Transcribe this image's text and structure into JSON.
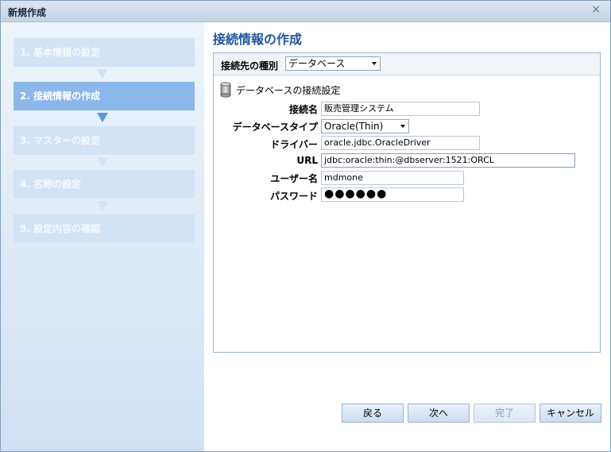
{
  "window": {
    "title": "新規作成",
    "close_glyph": "×"
  },
  "steps": [
    {
      "label": "1. 基本情報の設定",
      "active": false
    },
    {
      "label": "2. 接続情報の作成",
      "active": true
    },
    {
      "label": "3. マスターの設定",
      "active": false
    },
    {
      "label": "4. 名称の設定",
      "active": false
    },
    {
      "label": "5. 設定内容の確認",
      "active": false
    }
  ],
  "main": {
    "title": "接続情報の作成",
    "connection_type": {
      "label": "接続先の種別",
      "value": "データベース"
    },
    "section_title": "データベースの接続設定",
    "fields": {
      "name": {
        "label": "接続名",
        "value": "販売管理システム"
      },
      "db_type": {
        "label": "データベースタイプ",
        "value": "Oracle(Thin)"
      },
      "driver": {
        "label": "ドライバー",
        "value": "oracle.jdbc.OracleDriver"
      },
      "url": {
        "label": "URL",
        "value": "jdbc:oracle:thin:@dbserver:1521:ORCL"
      },
      "user": {
        "label": "ユーザー名",
        "value": "mdmone"
      },
      "password": {
        "label": "パスワード",
        "value": "●●●●●●"
      }
    }
  },
  "buttons": {
    "back": "戻る",
    "next": "次へ",
    "finish": "完了",
    "cancel": "キャンセル"
  },
  "colors": {
    "accent_title": "#2356a2",
    "active_step": "#8cb7ea",
    "inactive_step": "#d3e3f6"
  }
}
